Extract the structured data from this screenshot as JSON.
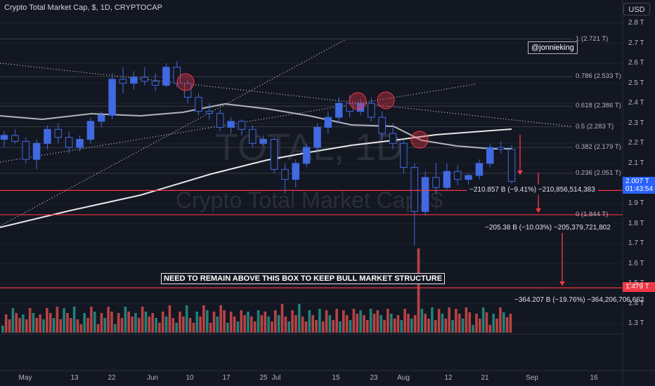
{
  "header": {
    "title": "Crypto Total Market Cap, $, 1D, CRYPTOCAP"
  },
  "currency_button": "USD",
  "watermark": {
    "symbol": "TOTAL, 1D",
    "name": "Crypto Total Market Cap, $"
  },
  "handle": "@jonnieking",
  "box_label": "NEED TO REMAIN ABOVE THIS BOX TO KEEP BULL MARKET STRUCTURE",
  "measurements": [
    "−210.857 B (−9.41%) −210,856,514,383",
    "−205.38 B (−10.03%) −205,379,721,802",
    "−364.207 B (−19.76%) −364,206,706,662"
  ],
  "price_tags": {
    "last_price": "2.007 T",
    "countdown": "01:43:54",
    "box_level": "1.479 T"
  },
  "colors": {
    "background": "#131722",
    "bullish": "#4169e1",
    "bearish": "#131722",
    "volume_up": "#26a69a",
    "volume_down": "#ef5350",
    "level_line": "#f23645",
    "moving_average_1": "#b2b5be",
    "moving_average_2": "#e6e6e6",
    "price_tag": "#2962ff"
  },
  "chart_data": {
    "type": "candlestick",
    "y_axis_unit": "T",
    "y_ticks": [
      "2.8 T",
      "2.7 T",
      "2.6 T",
      "2.5 T",
      "2.4 T",
      "2.3 T",
      "2.2 T",
      "2.1 T",
      "1.9 T",
      "1.8 T",
      "1.7 T",
      "1.6 T",
      "1.5 T",
      "1.4 T",
      "1.3 T"
    ],
    "y_tick_values": [
      2.8,
      2.7,
      2.6,
      2.5,
      2.4,
      2.3,
      2.2,
      2.1,
      1.9,
      1.8,
      1.7,
      1.6,
      1.5,
      1.4,
      1.3
    ],
    "x_ticks": [
      "May",
      "13",
      "22",
      "Jun",
      "10",
      "17",
      "25",
      "Jul",
      "15",
      "23",
      "Aug",
      "12",
      "21",
      "Sep",
      "16"
    ],
    "fib_levels": [
      {
        "label": "1 (2.721 T)",
        "value": 2.721
      },
      {
        "label": "0.786 (2.533 T)",
        "value": 2.533
      },
      {
        "label": "0.618 (2.386 T)",
        "value": 2.386
      },
      {
        "label": "0.5 (2.283 T)",
        "value": 2.283
      },
      {
        "label": "0.382 (2.179 T)",
        "value": 2.179
      },
      {
        "label": "0.236 (2.051 T)",
        "value": 2.051
      },
      {
        "label": "0 (1.844 T)",
        "value": 1.844
      }
    ],
    "horizontal_levels": [
      1.965,
      1.844,
      1.479
    ],
    "last_price": 2.007,
    "ohlc_sample": [
      [
        2.22,
        2.26,
        2.18,
        2.24
      ],
      [
        2.24,
        2.27,
        2.2,
        2.21
      ],
      [
        2.21,
        2.23,
        2.1,
        2.12
      ],
      [
        2.12,
        2.22,
        2.07,
        2.2
      ],
      [
        2.2,
        2.29,
        2.17,
        2.27
      ],
      [
        2.27,
        2.3,
        2.2,
        2.23
      ],
      [
        2.23,
        2.26,
        2.15,
        2.18
      ],
      [
        2.18,
        2.24,
        2.16,
        2.22
      ],
      [
        2.22,
        2.33,
        2.2,
        2.31
      ],
      [
        2.31,
        2.36,
        2.28,
        2.34
      ],
      [
        2.34,
        2.55,
        2.32,
        2.52
      ],
      [
        2.52,
        2.58,
        2.45,
        2.5
      ],
      [
        2.5,
        2.56,
        2.47,
        2.53
      ],
      [
        2.53,
        2.58,
        2.49,
        2.51
      ],
      [
        2.51,
        2.55,
        2.46,
        2.49
      ],
      [
        2.49,
        2.6,
        2.48,
        2.58
      ],
      [
        2.58,
        2.61,
        2.48,
        2.5
      ],
      [
        2.5,
        2.52,
        2.4,
        2.43
      ],
      [
        2.43,
        2.45,
        2.34,
        2.36
      ],
      [
        2.36,
        2.4,
        2.32,
        2.35
      ],
      [
        2.35,
        2.37,
        2.26,
        2.28
      ],
      [
        2.28,
        2.33,
        2.25,
        2.31
      ],
      [
        2.31,
        2.32,
        2.24,
        2.27
      ],
      [
        2.27,
        2.29,
        2.18,
        2.2
      ],
      [
        2.2,
        2.24,
        2.19,
        2.22
      ],
      [
        2.22,
        2.23,
        2.05,
        2.07
      ],
      [
        2.07,
        2.1,
        1.95,
        2.02
      ],
      [
        2.02,
        2.12,
        1.98,
        2.1
      ],
      [
        2.1,
        2.2,
        2.08,
        2.18
      ],
      [
        2.18,
        2.3,
        2.16,
        2.28
      ],
      [
        2.28,
        2.36,
        2.25,
        2.33
      ],
      [
        2.33,
        2.43,
        2.3,
        2.4
      ],
      [
        2.4,
        2.44,
        2.33,
        2.36
      ],
      [
        2.36,
        2.42,
        2.34,
        2.4
      ],
      [
        2.4,
        2.43,
        2.31,
        2.33
      ],
      [
        2.33,
        2.36,
        2.22,
        2.25
      ],
      [
        2.25,
        2.3,
        2.17,
        2.2
      ],
      [
        2.2,
        2.22,
        2.05,
        2.08
      ],
      [
        2.08,
        2.1,
        1.69,
        1.86
      ],
      [
        1.86,
        2.06,
        1.84,
        2.03
      ],
      [
        2.03,
        2.1,
        1.95,
        1.98
      ],
      [
        1.98,
        2.1,
        1.97,
        2.06
      ],
      [
        2.06,
        2.09,
        1.99,
        2.02
      ],
      [
        2.02,
        2.05,
        1.98,
        2.04
      ],
      [
        2.04,
        2.12,
        2.02,
        2.1
      ],
      [
        2.1,
        2.2,
        2.08,
        2.18
      ],
      [
        2.18,
        2.21,
        2.15,
        2.17
      ],
      [
        2.17,
        2.19,
        2.0,
        2.01
      ]
    ]
  }
}
